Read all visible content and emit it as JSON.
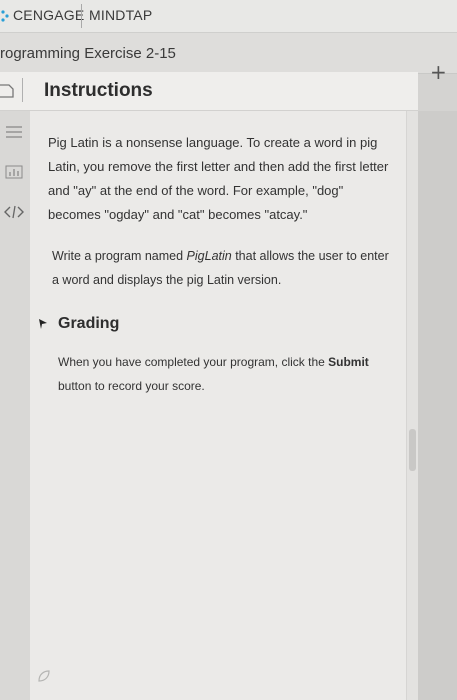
{
  "app": {
    "brand": "CENGAGE",
    "product": "MINDTAP"
  },
  "page": {
    "title": "rogramming Exercise 2-15"
  },
  "panel": {
    "title": "Instructions"
  },
  "instructions": {
    "paragraph1": "Pig Latin is a nonsense language. To create a word in pig Latin, you remove the first letter and then add the first letter and \"ay\" at the end of the word. For example, \"dog\" becomes \"ogday\" and \"cat\" becomes \"atcay.\"",
    "paragraph2_before": "Write a program named ",
    "paragraph2_program": "PigLatin",
    "paragraph2_after": " that allows the user to enter a word and displays the pig Latin version."
  },
  "grading": {
    "title": "Grading",
    "text_before": "When you have completed your program, click the ",
    "submit_word": "Submit",
    "text_after": " button to record your score."
  },
  "icons": {
    "brand": "cengage-logo-icon",
    "doc": "document-icon",
    "instructions": "list-icon",
    "results": "bar-chart-icon",
    "code": "code-icon",
    "add": "plus-icon",
    "collapse": "caret-icon",
    "bottom": "leaf-icon"
  },
  "colors": {
    "accent": "#2a9fd6",
    "text": "#333333"
  }
}
